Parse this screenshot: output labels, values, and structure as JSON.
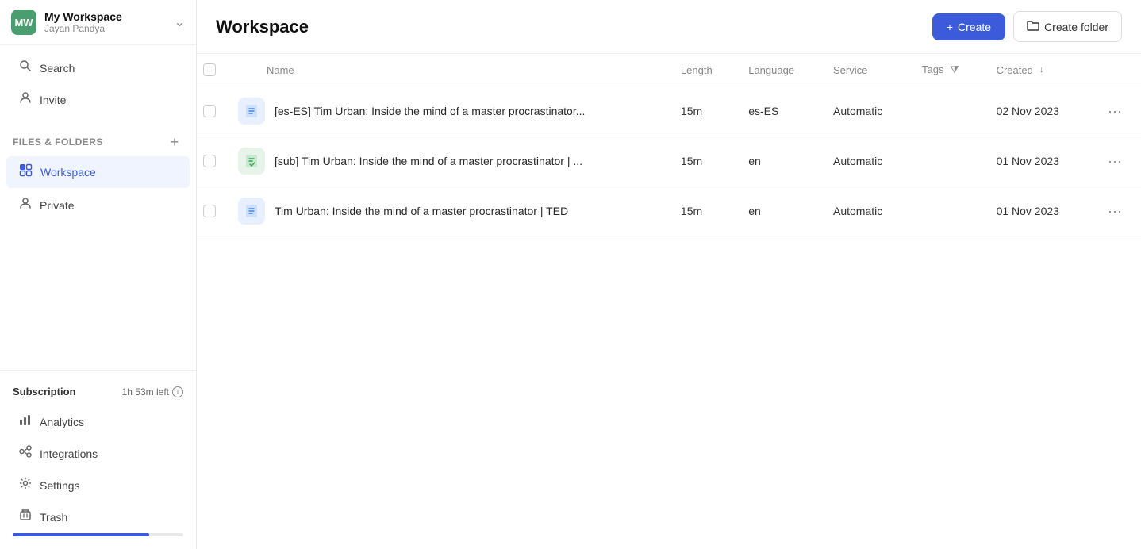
{
  "workspace": {
    "avatar_text": "MW",
    "name": "My Workspace",
    "user": "Jayan Pandya"
  },
  "sidebar": {
    "search_label": "Search",
    "invite_label": "Invite",
    "section_title": "Files & Folders",
    "nav_items": [
      {
        "id": "workspace",
        "label": "Workspace",
        "active": true
      },
      {
        "id": "private",
        "label": "Private",
        "active": false
      }
    ],
    "bottom_nav": [
      {
        "id": "analytics",
        "label": "Analytics"
      },
      {
        "id": "integrations",
        "label": "Integrations"
      },
      {
        "id": "settings",
        "label": "Settings"
      },
      {
        "id": "trash",
        "label": "Trash"
      }
    ],
    "subscription": {
      "label": "Subscription",
      "time_left": "1h 53m left"
    }
  },
  "main": {
    "title": "Workspace",
    "create_button": "+ Create",
    "create_folder_button": "Create folder",
    "table": {
      "columns": [
        {
          "id": "name",
          "label": "Name"
        },
        {
          "id": "length",
          "label": "Length"
        },
        {
          "id": "language",
          "label": "Language"
        },
        {
          "id": "service",
          "label": "Service"
        },
        {
          "id": "tags",
          "label": "Tags"
        },
        {
          "id": "created",
          "label": "Created"
        }
      ],
      "rows": [
        {
          "id": 1,
          "name": "[es-ES] Tim Urban: Inside the mind of a master procrastinator...",
          "length": "15m",
          "language": "es-ES",
          "service": "Automatic",
          "tags": "",
          "created": "02 Nov 2023",
          "icon_type": "blue"
        },
        {
          "id": 2,
          "name": "[sub] Tim Urban: Inside the mind of a master procrastinator | ...",
          "length": "15m",
          "language": "en",
          "service": "Automatic",
          "tags": "",
          "created": "01 Nov 2023",
          "icon_type": "green"
        },
        {
          "id": 3,
          "name": "Tim Urban: Inside the mind of a master procrastinator | TED",
          "length": "15m",
          "language": "en",
          "service": "Automatic",
          "tags": "",
          "created": "01 Nov 2023",
          "icon_type": "blue"
        }
      ]
    }
  }
}
